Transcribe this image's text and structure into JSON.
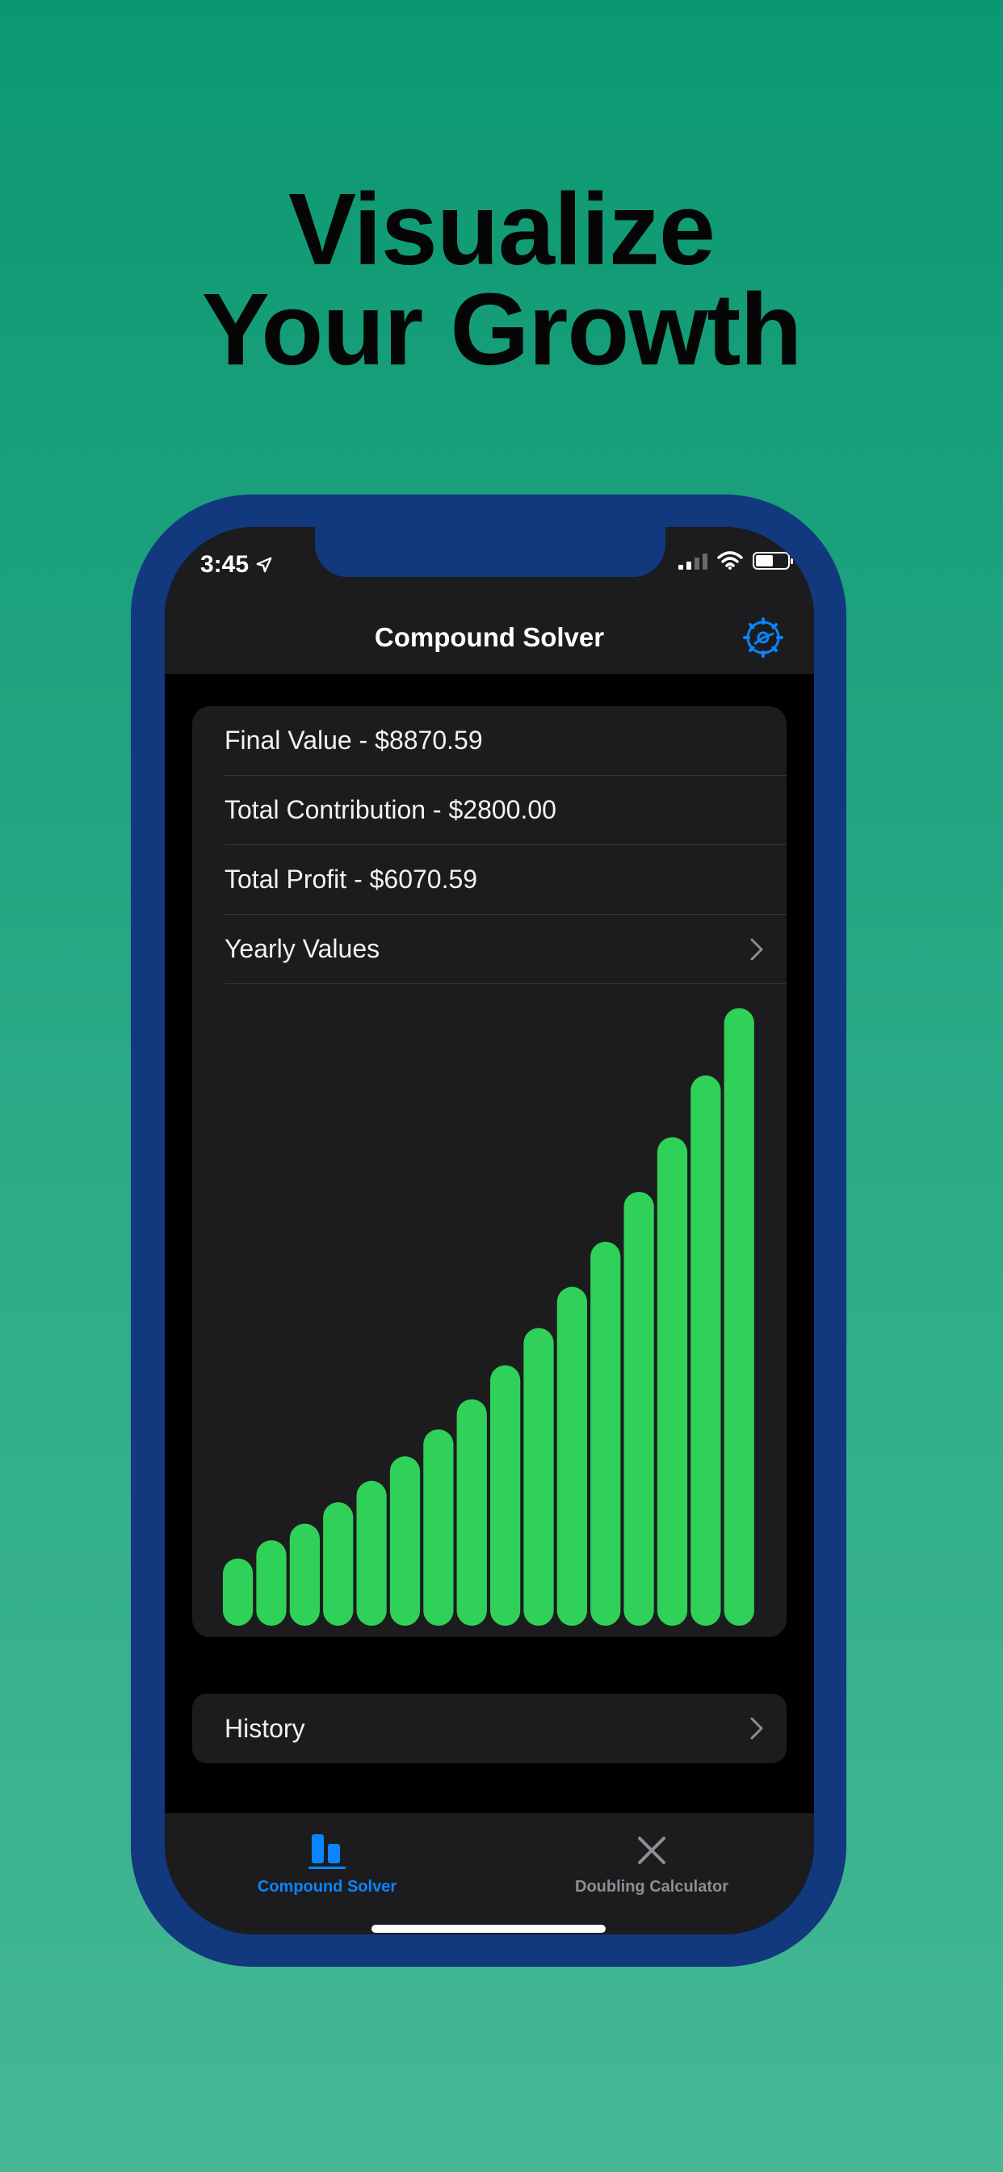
{
  "headline": {
    "line1": "Visualize",
    "line2": "Your Growth"
  },
  "status_bar": {
    "time": "3:45"
  },
  "nav": {
    "title": "Compound Solver"
  },
  "summary": {
    "final_value": "Final Value - $8870.59",
    "total_contribution": "Total Contribution - $2800.00",
    "total_profit": "Total Profit - $6070.59",
    "yearly_values": "Yearly Values"
  },
  "chart_data": {
    "type": "bar",
    "values": [
      850,
      1080,
      1290,
      1560,
      1830,
      2140,
      2480,
      2860,
      3290,
      3760,
      4280,
      4850,
      5480,
      6170,
      6950,
      7800
    ],
    "ylim": [
      0,
      8000
    ],
    "grid": false,
    "bar_color": "#30d158"
  },
  "history": {
    "label": "History"
  },
  "tabs": [
    {
      "label": "Compound Solver",
      "active": true,
      "color": "#0a84ff"
    },
    {
      "label": "Doubling Calculator",
      "active": false,
      "color": "#8e8e93"
    }
  ],
  "colors": {
    "accent": "#0a84ff",
    "bar": "#30d158",
    "frame": "#12387d"
  }
}
